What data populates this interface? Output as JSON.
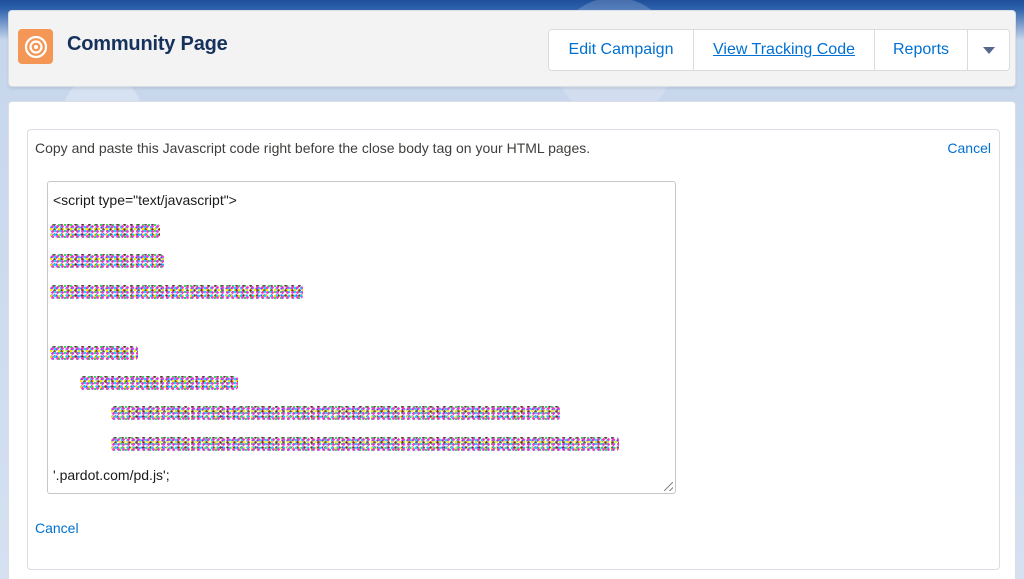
{
  "header": {
    "title": "Community Page",
    "icon": "campaign-target-icon",
    "icon_color": "#f49756",
    "actions": {
      "edit_campaign": "Edit Campaign",
      "view_tracking_code": "View Tracking Code",
      "reports": "Reports"
    }
  },
  "panel": {
    "instructions": "Copy and paste this Javascript code right before the close body tag on your HTML pages.",
    "cancel_top": "Cancel",
    "cancel_bottom": "Cancel",
    "code": {
      "first_line": "<script type=\"text/javascript\">",
      "last_line": "'.pardot.com/pd.js';"
    }
  },
  "colors": {
    "link": "#0070d2",
    "title": "#16325c"
  }
}
